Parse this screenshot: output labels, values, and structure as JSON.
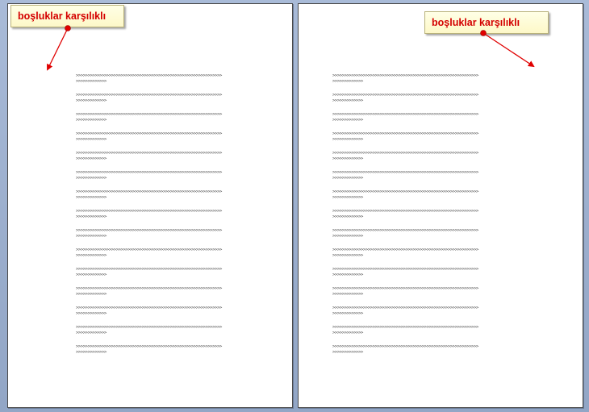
{
  "callouts": {
    "left": "boşluklar karşılıklı",
    "right": "boşluklar karşılıklı"
  },
  "document": {
    "paragraph_line_1": ">>>>>>>>>>>>>>>>>>>>>>>>>>>>>>>>>>>>>>>>>>>>>>>>>>>>>>>>>>>>>>",
    "paragraph_line_2": ">>>>>>>>>>>>>",
    "pages": [
      {
        "id": "left"
      },
      {
        "id": "right"
      }
    ]
  },
  "colors": {
    "callout_text": "#d40000",
    "callout_background": "#ffffdd",
    "arrow": "#e00000",
    "workspace": "#9fb1cf"
  }
}
